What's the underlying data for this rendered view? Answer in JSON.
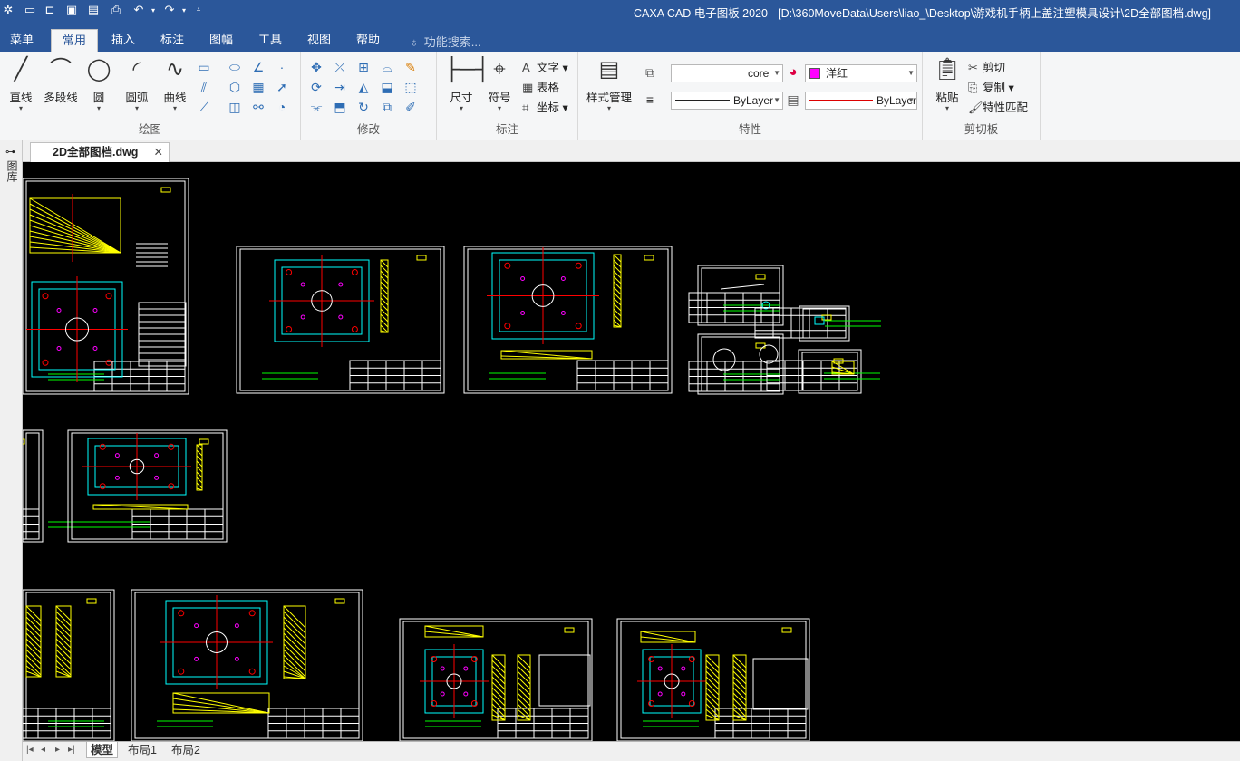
{
  "window": {
    "title": "CAXA CAD 电子图板 2020 - [D:\\360MoveData\\Users\\liao_\\Desktop\\游戏机手柄上盖注塑模具设计\\2D全部图档.dwg]"
  },
  "quick_access": {
    "icons": [
      "app-logo-icon",
      "new-file-icon",
      "open-file-icon",
      "save-icon",
      "save-as-icon",
      "print-icon",
      "undo-icon",
      "redo-icon",
      "customize-icon"
    ]
  },
  "ribbon_tabs": {
    "menu": "菜单",
    "items": [
      "常用",
      "插入",
      "标注",
      "图幅",
      "工具",
      "视图",
      "帮助"
    ],
    "active": "常用",
    "search_placeholder": "功能搜索..."
  },
  "ribbon": {
    "draw": {
      "label": "绘图",
      "buttons": [
        "直线",
        "多段线",
        "圆",
        "圆弧",
        "曲线"
      ]
    },
    "modify": {
      "label": "修改"
    },
    "annotate": {
      "label": "标注",
      "buttons": [
        "尺寸",
        "符号"
      ],
      "small": [
        "文字",
        "表格",
        "坐标"
      ]
    },
    "properties": {
      "label": "特性",
      "style_manager": "样式管理",
      "layer_value": "core",
      "color_value": "洋红",
      "linetype_value": "ByLayer",
      "lineweight_value": "ByLayer",
      "color_swatch": "#ff00ff"
    },
    "clipboard": {
      "label": "剪切板",
      "paste": "粘贴",
      "cut": "剪切",
      "copy": "复制",
      "match": "特性匹配"
    }
  },
  "document": {
    "tab_name": "2D全部图档.dwg",
    "side_panel_label": "图库"
  },
  "layout_tabs": {
    "items": [
      "模型",
      "布局1",
      "布局2"
    ],
    "active": "模型"
  },
  "colors": {
    "ribbon_blue": "#2b579a",
    "canvas_bg": "#000000",
    "sheet_border": "#ffffff",
    "cad_cyan": "#00ffff",
    "cad_yellow": "#ffff00",
    "cad_red": "#ff0000",
    "cad_green": "#00ff00",
    "cad_magenta": "#ff00ff"
  }
}
